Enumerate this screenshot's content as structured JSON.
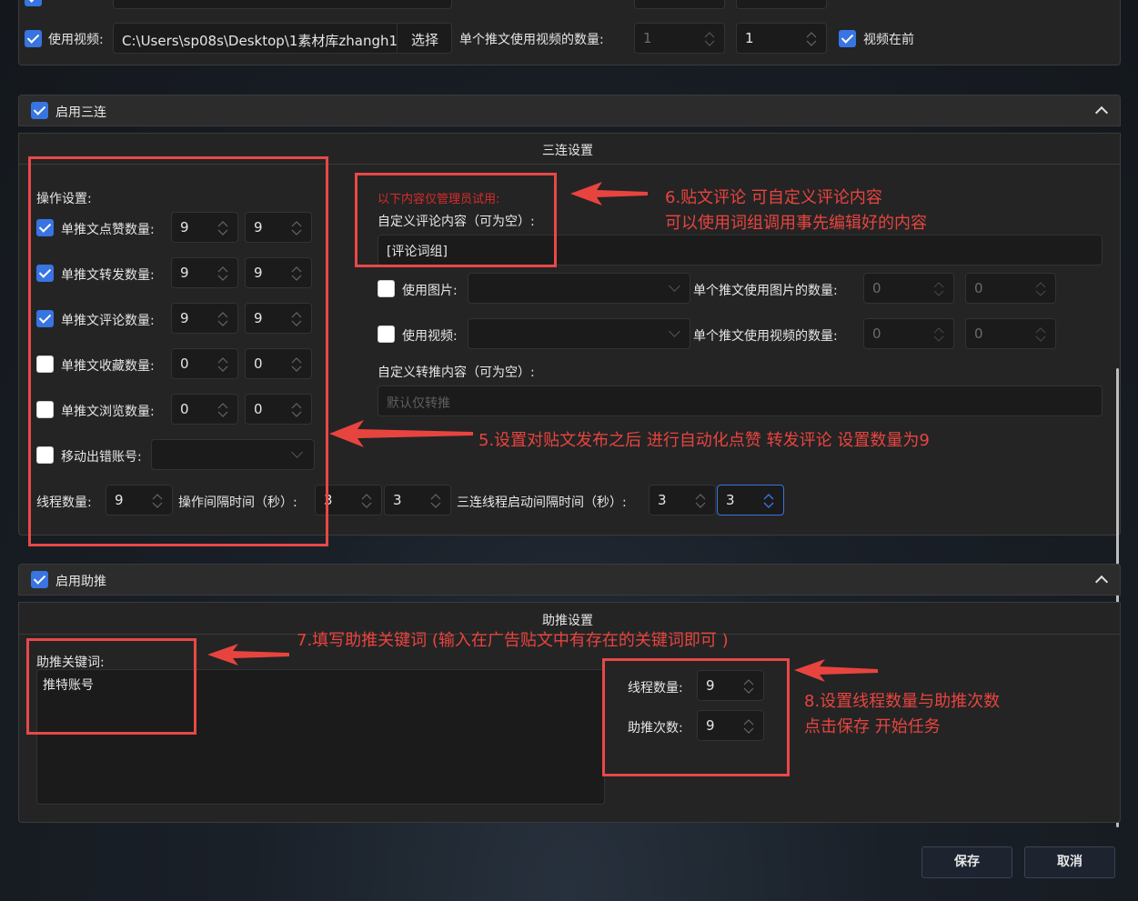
{
  "top": {
    "use_video_label": "使用视频:",
    "video_path": "C:\\Users\\sp08s\\Desktop\\1素材库zhangh1",
    "choose_label": "选择",
    "per_tweet_video_label": "单个推文使用视频的数量:",
    "video_min": "1",
    "video_max": "1",
    "video_first_label": "视频在前"
  },
  "triple": {
    "enable_label": "启用三连",
    "settings_title": "三连设置",
    "ops_title": "操作设置:",
    "like_label": "单推文点赞数量:",
    "like_min": "9",
    "like_max": "9",
    "retweet_label": "单推文转发数量:",
    "retweet_min": "9",
    "retweet_max": "9",
    "comment_label": "单推文评论数量:",
    "comment_min": "9",
    "comment_max": "9",
    "fav_label": "单推文收藏数量:",
    "fav_min": "0",
    "fav_max": "0",
    "view_label": "单推文浏览数量:",
    "view_min": "0",
    "view_max": "0",
    "move_err_label": "移动出错账号:",
    "threads_label": "线程数量:",
    "threads_value": "9",
    "interval_label": "操作间隔时间（秒）:",
    "interval_min": "3",
    "interval_max": "3",
    "start_interval_label": "三连线程启动间隔时间（秒）:",
    "start_min": "3",
    "start_max": "3",
    "admin_note": "以下内容仅管理员试用:",
    "custom_comment_label": "自定义评论内容（可为空）:",
    "custom_comment_value": "[评论词组]",
    "use_image_label": "使用图片:",
    "per_tweet_image_label": "单个推文使用图片的数量:",
    "img_min": "0",
    "img_max": "0",
    "use_video_label": "使用视频:",
    "per_tweet_video_label": "单个推文使用视频的数量:",
    "vid_min": "0",
    "vid_max": "0",
    "custom_retweet_label": "自定义转推内容（可为空）:",
    "custom_retweet_placeholder": "默认仅转推"
  },
  "boost": {
    "enable_label": "启用助推",
    "settings_title": "助推设置",
    "keyword_label": "助推关键词:",
    "keyword_value": "推特账号",
    "threads_label": "线程数量:",
    "threads_value": "9",
    "count_label": "助推次数:",
    "count_value": "9"
  },
  "footer": {
    "save_label": "保存",
    "cancel_label": "取消"
  },
  "annotations": {
    "a6_line1": "6.贴文评论 可自定义评论内容",
    "a6_line2": "可以使用词组调用事先编辑好的内容",
    "a5": "5.设置对贴文发布之后 进行自动化点赞 转发评论 设置数量为9",
    "a7": "7.填写助推关键词 (输入在广告贴文中有存在的关键词即可 )",
    "a8_line1": "8.设置线程数量与助推次数",
    "a8_line2": "点击保存 开始任务"
  },
  "colors": {
    "accent": "#3874e2",
    "annotation": "#e8443f"
  }
}
